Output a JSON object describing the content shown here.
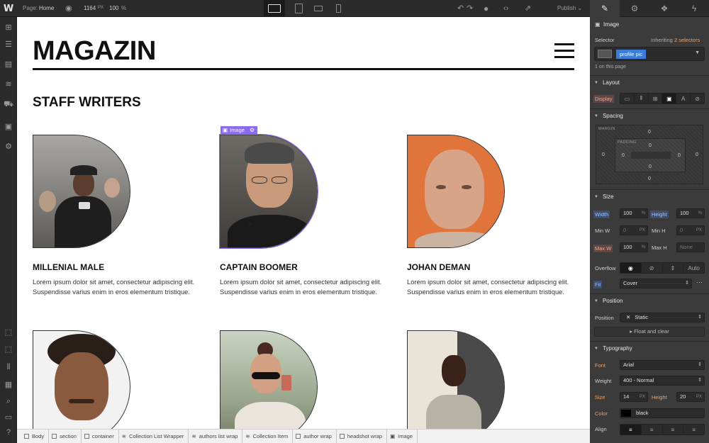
{
  "topbar": {
    "logo": "W",
    "page_label": "Page:",
    "page_name": "Home",
    "width": "1164",
    "width_unit": "PX",
    "zoom": "100",
    "zoom_unit": "%",
    "publish_label": "Publish"
  },
  "canvas": {
    "brand": "MAGAZIN",
    "section_title": "STAFF WRITERS",
    "image_badge_label": "Image",
    "writers": [
      {
        "name": "MILLENIAL MALE",
        "bio": "Lorem ipsum dolor sit amet, consectetur adipiscing elit. Suspendisse varius enim in eros elementum tristique."
      },
      {
        "name": "CAPTAIN BOOMER",
        "bio": "Lorem ipsum dolor sit amet, consectetur adipiscing elit. Suspendisse varius enim in eros elementum tristique."
      },
      {
        "name": "JOHAN DEMAN",
        "bio": "Lorem ipsum dolor sit amet, consectetur adipiscing elit. Suspendisse varius enim in eros elementum tristique."
      }
    ]
  },
  "breadcrumb": [
    "Body",
    "section",
    "container",
    "Collection List Wrapper",
    "authors list wrap",
    "Collection Item",
    "author wrap",
    "headshot wrap",
    "Image"
  ],
  "panel": {
    "element_type": "Image",
    "selector_label": "Selector",
    "inheriting_prefix": "Inheriting",
    "inheriting_count": "2 selectors",
    "selector_chip": "profile pic",
    "on_page": "1 on this page",
    "layout": {
      "title": "Layout",
      "display_label": "Display"
    },
    "spacing": {
      "title": "Spacing",
      "margin_tag": "MARGIN",
      "padding_tag": "PADDING",
      "margin_top": "0",
      "margin_right": "0",
      "margin_bottom": "0",
      "margin_left": "0",
      "padding_top": "0",
      "padding_right": "0",
      "padding_bottom": "0",
      "padding_left": "0"
    },
    "size": {
      "title": "Size",
      "width_label": "Width",
      "width_value": "100",
      "width_unit": "%",
      "height_label": "Height",
      "height_value": "100",
      "height_unit": "%",
      "minw_label": "Min W",
      "minw_value": "0",
      "minw_unit": "PX",
      "minh_label": "Min H",
      "minh_value": "0",
      "minh_unit": "PX",
      "maxw_label": "Max W",
      "maxw_value": "100",
      "maxw_unit": "%",
      "maxh_label": "Max H",
      "maxh_value": "None",
      "overflow_label": "Overflow",
      "overflow_auto": "Auto",
      "fit_label": "Fit",
      "fit_value": "Cover"
    },
    "position": {
      "title": "Position",
      "position_label": "Position",
      "position_value": "Static",
      "float_label": "Float and clear"
    },
    "typography": {
      "title": "Typography",
      "font_label": "Font",
      "font_value": "Arial",
      "weight_label": "Weight",
      "weight_value": "400 - Normal",
      "size_label": "Size",
      "size_value": "14",
      "size_unit": "PX",
      "height_label": "Height",
      "height_value": "20",
      "height_unit": "PX",
      "color_label": "Color",
      "color_value": "black",
      "color_swatch": "#000000",
      "align_label": "Align"
    }
  },
  "colors": {
    "accent": "#8a6cf0",
    "selector_chip": "#3d7bd9",
    "inherit_orange": "#f0a060"
  }
}
